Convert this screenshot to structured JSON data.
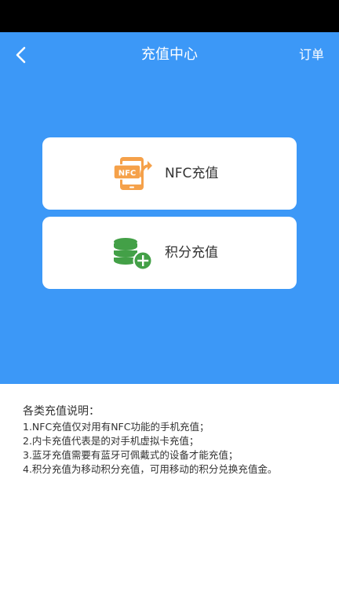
{
  "header": {
    "title": "充值中心",
    "right_action": "订单",
    "back_icon": "chevron-left-icon"
  },
  "options": [
    {
      "label": "NFC充值",
      "icon": "nfc-phone-icon",
      "icon_text": "NFC",
      "icon_color": "#f5a14a"
    },
    {
      "label": "积分充值",
      "icon": "coin-stack-plus-icon",
      "icon_color": "#43a047"
    }
  ],
  "notes": {
    "title": "各类充值说明：",
    "items": [
      "1.NFC充值仅对用有NFC功能的手机充值；",
      "2.内卡充值代表是的对手机虚拟卡充值；",
      "3.蓝牙充值需要有蓝牙可佩戴式的设备才能充值；",
      "4.积分充值为移动积分充值，可用移动的积分兑换充值金。"
    ]
  },
  "colors": {
    "primary": "#3c98f7",
    "status_bar": "#000000",
    "text": "#333333"
  }
}
